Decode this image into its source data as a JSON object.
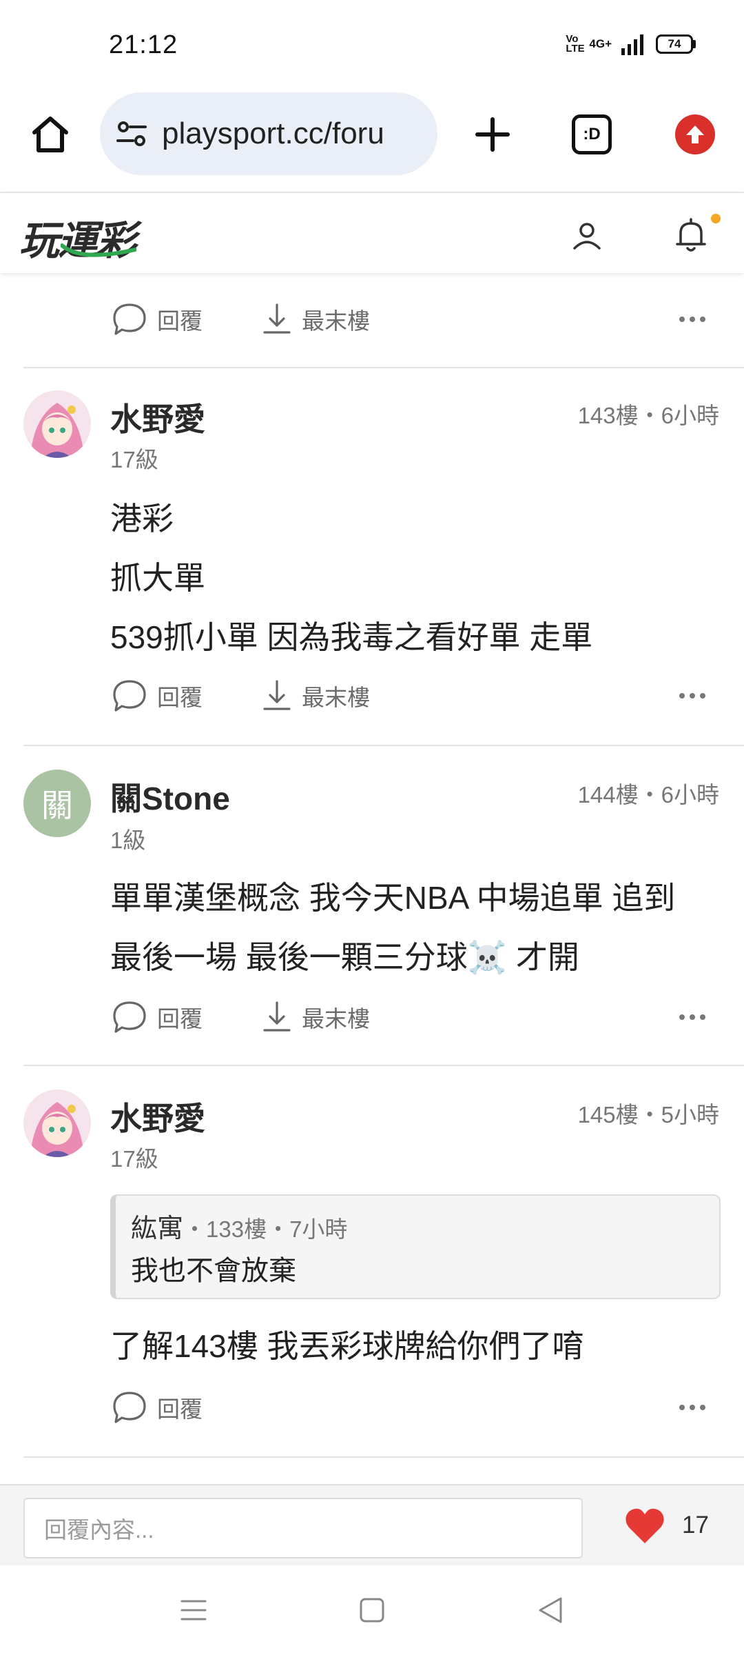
{
  "status_bar": {
    "time": "21:12",
    "network_labels": [
      "Vo LTE",
      "4G+"
    ],
    "battery": "74"
  },
  "browser": {
    "url": "playsport.cc/foru",
    "tabs_label": ":D",
    "icons": [
      "home-icon",
      "site-settings-icon",
      "plus-icon",
      "tab-switcher-icon",
      "extension-icon"
    ],
    "extension_color": "#d9302c"
  },
  "site": {
    "logo": "玩運彩",
    "logo_accent": "#2fa84f",
    "icons": [
      "user-icon",
      "bell-icon"
    ],
    "notification_dot_color": "#f5a623"
  },
  "actions": {
    "reply": "回覆",
    "last_floor": "最末樓",
    "more": "more-icon"
  },
  "posts": [
    {
      "username": "水野愛",
      "level": "17級",
      "meta": "143樓・6小時",
      "avatar": "anime-avatar",
      "lines": [
        "港彩",
        "抓大單",
        "539抓小單 因為我毒之看好單 走單"
      ]
    },
    {
      "username": "關Stone",
      "avatar_letter": "關",
      "avatar_color": "#a9c3a3",
      "level": "1級",
      "meta": "144樓・6小時",
      "lines": [
        "單單漢堡概念 我今天NBA 中場追單 追到",
        "最後一場 最後一顆三分球☠️ 才開"
      ]
    },
    {
      "username": "水野愛",
      "level": "17級",
      "meta": "145樓・5小時",
      "avatar": "anime-avatar",
      "quote": {
        "author": "紘寓",
        "meta": "・133樓・7小時",
        "text": "我也不會放棄"
      },
      "lines": [
        "了解143樓 我丟彩球牌給你們了唷"
      ]
    }
  ],
  "reply_bar": {
    "placeholder": "回覆內容...",
    "like_count": "17",
    "like_color": "#e53935"
  },
  "nav": {
    "icons": [
      "menu-icon",
      "home-square-icon",
      "back-icon"
    ]
  }
}
